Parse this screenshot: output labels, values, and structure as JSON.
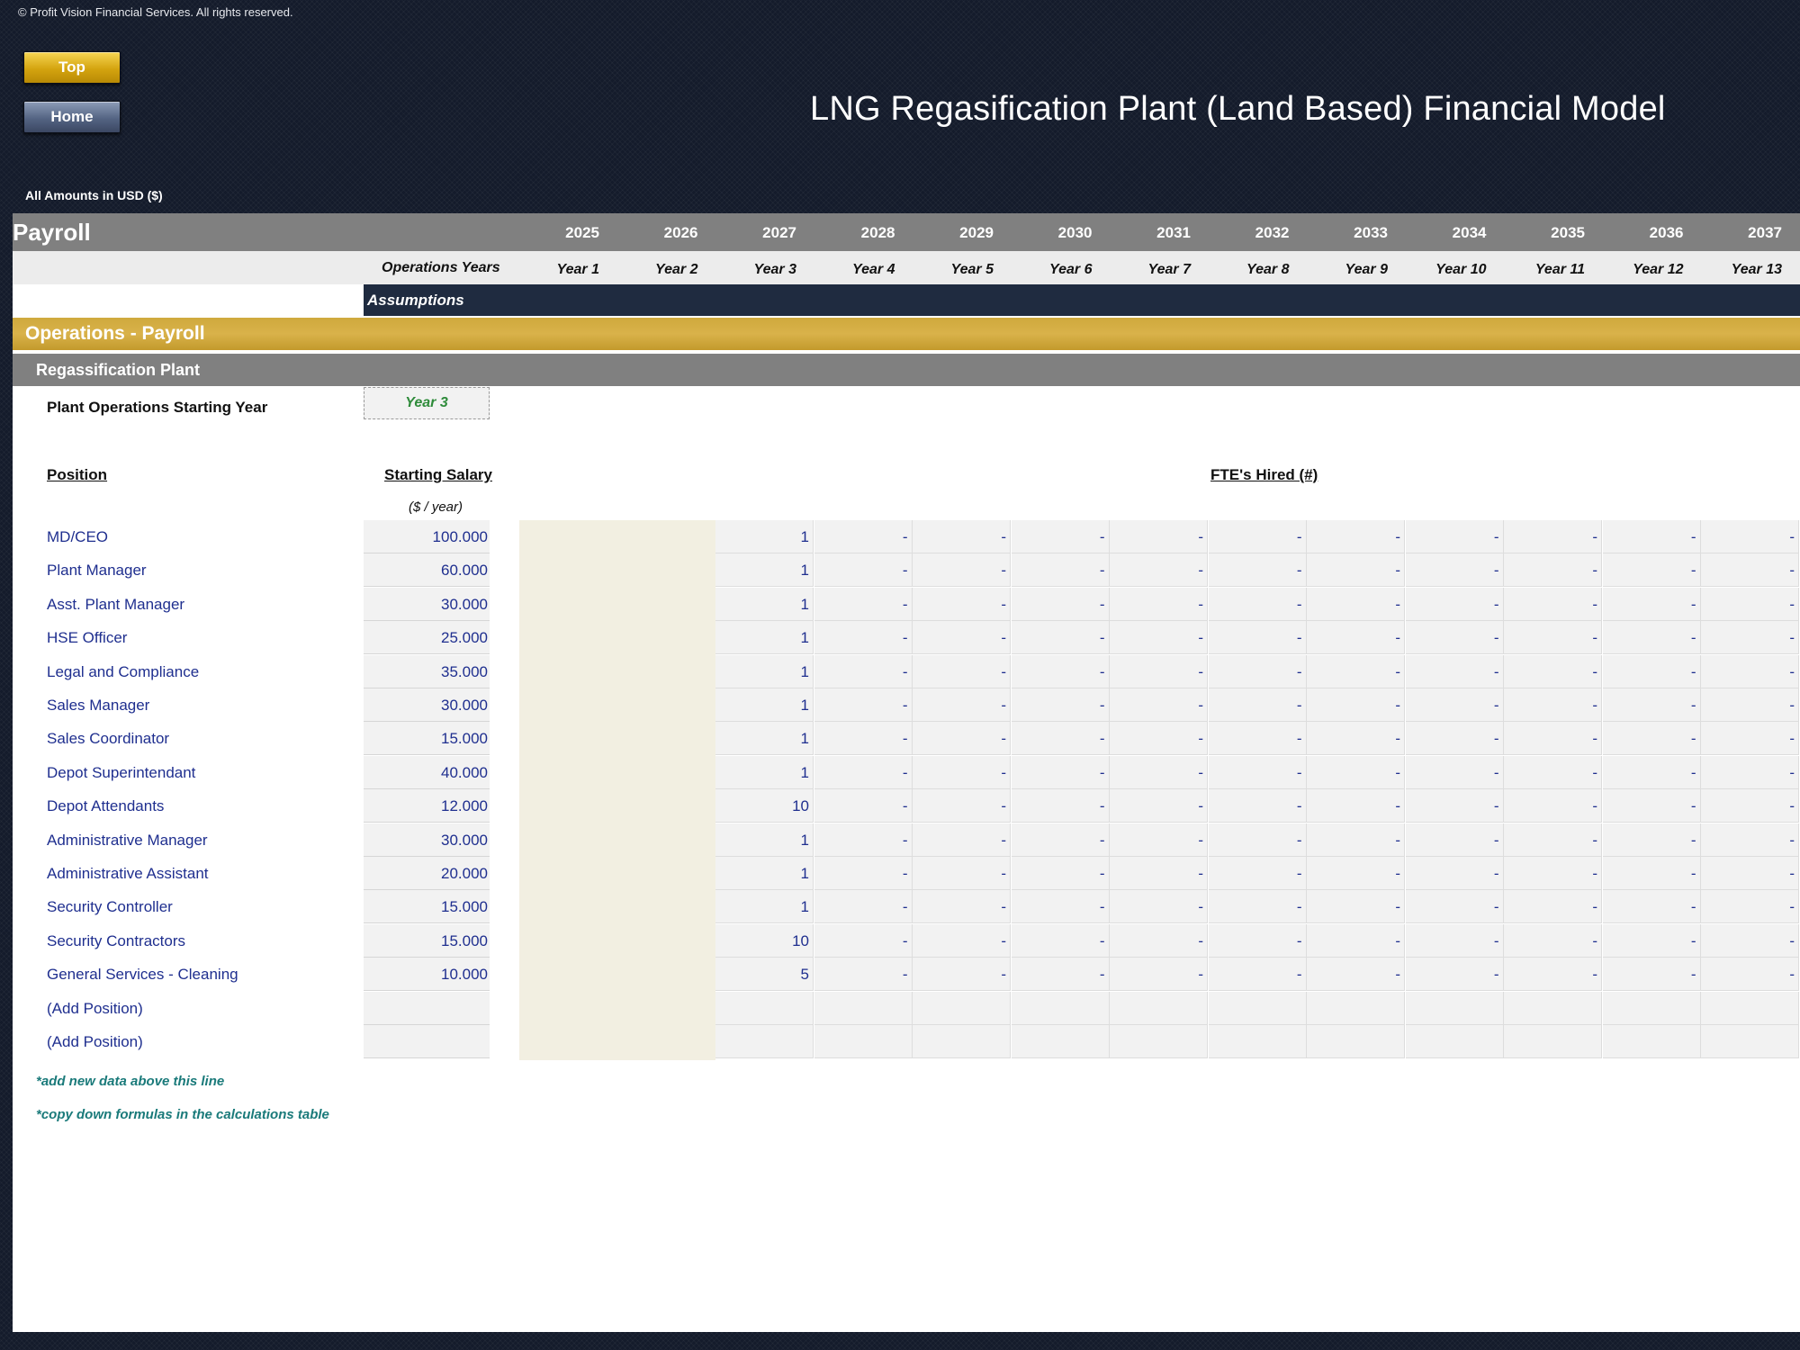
{
  "copyright": "© Profit Vision Financial Services. All rights reserved.",
  "nav": {
    "top_label": "Top",
    "home_label": "Home"
  },
  "title": "LNG Regasification Plant (Land Based) Financial Model",
  "amounts_note": "All Amounts in  USD ($)",
  "sheet_title": "Payroll",
  "years": [
    "2025",
    "2026",
    "2027",
    "2028",
    "2029",
    "2030",
    "2031",
    "2032",
    "2033",
    "2034",
    "2035",
    "2036",
    "2037"
  ],
  "operations_years_label": "Operations Years",
  "operation_years": [
    "Year 1",
    "Year 2",
    "Year 3",
    "Year 4",
    "Year 5",
    "Year 6",
    "Year 7",
    "Year 8",
    "Year 9",
    "Year 10",
    "Year 11",
    "Year 12",
    "Year 13"
  ],
  "assumptions_label": "Assumptions",
  "section": "Operations - Payroll",
  "subsection": "Regassification Plant",
  "start_year": {
    "label": "Plant Operations Starting Year",
    "value": "Year 3"
  },
  "columns": {
    "position": "Position",
    "salary": "Starting Salary",
    "salary_units": "($ / year)",
    "fte": "FTE's Hired (#)"
  },
  "positions": [
    {
      "name": "MD/CEO",
      "salary": "100.000",
      "fte": [
        "1",
        "-",
        "-",
        "-",
        "-",
        "-",
        "-",
        "-",
        "-",
        "-",
        "-"
      ]
    },
    {
      "name": "Plant Manager",
      "salary": "60.000",
      "fte": [
        "1",
        "-",
        "-",
        "-",
        "-",
        "-",
        "-",
        "-",
        "-",
        "-",
        "-"
      ]
    },
    {
      "name": "Asst. Plant Manager",
      "salary": "30.000",
      "fte": [
        "1",
        "-",
        "-",
        "-",
        "-",
        "-",
        "-",
        "-",
        "-",
        "-",
        "-"
      ]
    },
    {
      "name": "HSE Officer",
      "salary": "25.000",
      "fte": [
        "1",
        "-",
        "-",
        "-",
        "-",
        "-",
        "-",
        "-",
        "-",
        "-",
        "-"
      ]
    },
    {
      "name": "Legal and Compliance",
      "salary": "35.000",
      "fte": [
        "1",
        "-",
        "-",
        "-",
        "-",
        "-",
        "-",
        "-",
        "-",
        "-",
        "-"
      ]
    },
    {
      "name": "Sales Manager",
      "salary": "30.000",
      "fte": [
        "1",
        "-",
        "-",
        "-",
        "-",
        "-",
        "-",
        "-",
        "-",
        "-",
        "-"
      ]
    },
    {
      "name": "Sales Coordinator",
      "salary": "15.000",
      "fte": [
        "1",
        "-",
        "-",
        "-",
        "-",
        "-",
        "-",
        "-",
        "-",
        "-",
        "-"
      ]
    },
    {
      "name": "Depot Superintendant",
      "salary": "40.000",
      "fte": [
        "1",
        "-",
        "-",
        "-",
        "-",
        "-",
        "-",
        "-",
        "-",
        "-",
        "-"
      ]
    },
    {
      "name": "Depot Attendants",
      "salary": "12.000",
      "fte": [
        "10",
        "-",
        "-",
        "-",
        "-",
        "-",
        "-",
        "-",
        "-",
        "-",
        "-"
      ]
    },
    {
      "name": "Administrative Manager",
      "salary": "30.000",
      "fte": [
        "1",
        "-",
        "-",
        "-",
        "-",
        "-",
        "-",
        "-",
        "-",
        "-",
        "-"
      ]
    },
    {
      "name": "Administrative Assistant",
      "salary": "20.000",
      "fte": [
        "1",
        "-",
        "-",
        "-",
        "-",
        "-",
        "-",
        "-",
        "-",
        "-",
        "-"
      ]
    },
    {
      "name": "Security Controller",
      "salary": "15.000",
      "fte": [
        "1",
        "-",
        "-",
        "-",
        "-",
        "-",
        "-",
        "-",
        "-",
        "-",
        "-"
      ]
    },
    {
      "name": "Security Contractors",
      "salary": "15.000",
      "fte": [
        "10",
        "-",
        "-",
        "-",
        "-",
        "-",
        "-",
        "-",
        "-",
        "-",
        "-"
      ]
    },
    {
      "name": "General Services - Cleaning",
      "salary": "10.000",
      "fte": [
        "5",
        "-",
        "-",
        "-",
        "-",
        "-",
        "-",
        "-",
        "-",
        "-",
        "-"
      ]
    },
    {
      "name": "(Add Position)",
      "salary": "",
      "fte": [
        "",
        "",
        "",
        "",
        "",
        "",
        "",
        "",
        "",
        "",
        ""
      ]
    },
    {
      "name": "(Add Position)",
      "salary": "",
      "fte": [
        "",
        "",
        "",
        "",
        "",
        "",
        "",
        "",
        "",
        "",
        ""
      ]
    }
  ],
  "notes": [
    "*add new data above this line",
    "*copy down formulas in the calculations table"
  ]
}
